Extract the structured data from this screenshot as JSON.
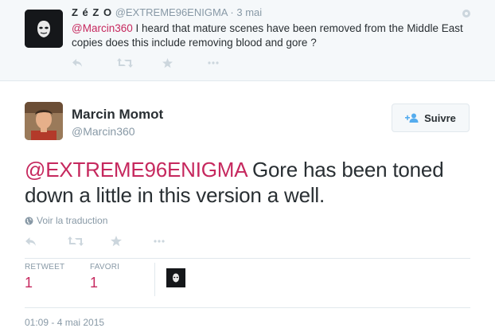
{
  "reply_tweet": {
    "fullname": "Z é Z O",
    "screenname": "@EXTREME96ENIGMA",
    "separator": "·",
    "time": "3 mai",
    "mention": "@Marcin360",
    "text": " I heard that mature scenes have been removed from the Middle East copies does this include removing blood and gore ?",
    "actions": [
      "reply-icon",
      "retweet-icon",
      "favorite-icon",
      "more-icon"
    ]
  },
  "main_tweet": {
    "fullname": "Marcin Momot",
    "screenname": "@Marcin360",
    "follow_label": "Suivre",
    "mention": "@EXTREME96ENIGMA",
    "text": " Gore has been toned down a little in this version a well.",
    "translate_label": "Voir la traduction",
    "actions": [
      "reply-icon",
      "retweet-icon",
      "favorite-icon",
      "more-icon"
    ]
  },
  "stats": {
    "retweet_label": "RETWEET",
    "retweet_count": "1",
    "favorite_label": "FAVORI",
    "favorite_count": "1"
  },
  "timestamp": "01:09 - 4 mai 2015",
  "colors": {
    "mention": "#c6285e",
    "muted": "#8899a6",
    "text": "#292f33",
    "reply_bg": "#f5f8fa",
    "border": "#e1e8ed"
  }
}
